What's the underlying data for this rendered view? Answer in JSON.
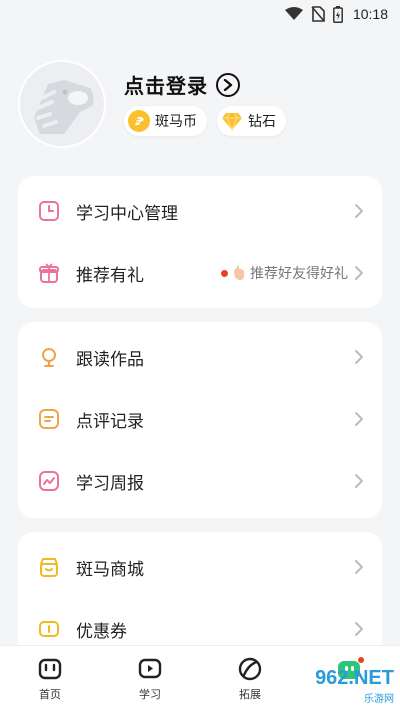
{
  "status_bar": {
    "time": "10:18"
  },
  "profile": {
    "login_text": "点击登录",
    "badges": [
      {
        "label": "斑马币",
        "icon": "zebra-coin-icon"
      },
      {
        "label": "钻石",
        "icon": "diamond-icon"
      }
    ]
  },
  "menu": {
    "card1": [
      {
        "label": "学习中心管理",
        "icon": "clock-icon"
      },
      {
        "label": "推荐有礼",
        "icon": "gift-icon",
        "hint": "推荐好友得好礼"
      }
    ],
    "card2": [
      {
        "label": "跟读作品",
        "icon": "microphone-icon"
      },
      {
        "label": "点评记录",
        "icon": "comment-icon"
      },
      {
        "label": "学习周报",
        "icon": "report-icon"
      }
    ],
    "card3": [
      {
        "label": "斑马商城",
        "icon": "store-icon"
      },
      {
        "label": "优惠券",
        "icon": "coupon-icon"
      }
    ]
  },
  "bottom_nav": [
    {
      "label": "首页",
      "icon": "home-icon"
    },
    {
      "label": "学习",
      "icon": "study-icon"
    },
    {
      "label": "拓展",
      "icon": "explore-icon"
    },
    {
      "label": "",
      "icon": "mascot-icon"
    }
  ],
  "watermark": {
    "main": "962.NET",
    "sub": "乐游网"
  },
  "colors": {
    "accent_pink": "#e9739a",
    "accent_orange": "#f0a44a",
    "accent_yellow": "#f3b824",
    "mascot_green": "#2ec47a"
  }
}
